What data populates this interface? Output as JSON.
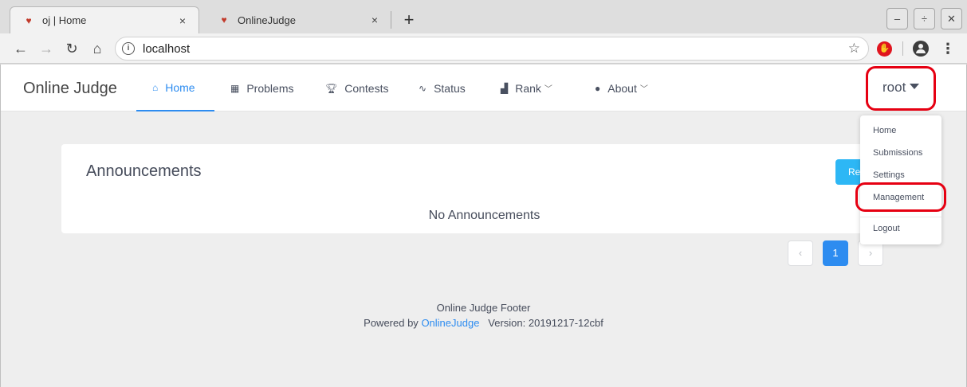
{
  "browser": {
    "tabs": [
      {
        "title": "oj | Home",
        "favicon": "oj-logo-icon"
      },
      {
        "title": "OnlineJudge",
        "favicon": "oj-logo-icon"
      }
    ],
    "new_tab_symbol": "+",
    "tab_close_symbol": "×",
    "window_buttons": [
      "–",
      "÷",
      "✕"
    ],
    "address": "localhost"
  },
  "site": {
    "brand": "Online Judge",
    "nav": [
      {
        "label": "Home",
        "icon": "home-icon",
        "active": true
      },
      {
        "label": "Problems",
        "icon": "grid-icon"
      },
      {
        "label": "Contests",
        "icon": "trophy-icon"
      },
      {
        "label": "Status",
        "icon": "pulse-icon"
      },
      {
        "label": "Rank",
        "icon": "bar-chart-icon",
        "has_dropdown": true
      },
      {
        "label": "About",
        "icon": "info-icon",
        "has_dropdown": true
      }
    ],
    "user": "root",
    "user_menu": [
      "Home",
      "Submissions",
      "Settings",
      "Management",
      "Logout"
    ]
  },
  "announcements": {
    "title": "Announcements",
    "refresh_label": "Refresh",
    "empty_message": "No Announcements"
  },
  "pagination": {
    "prev": "‹",
    "current": "1",
    "next": "›"
  },
  "footer": {
    "line1": "Online Judge Footer",
    "powered_prefix": "Powered by",
    "powered_link": "OnlineJudge",
    "version": "Version: 20191217-12cbf"
  },
  "colors": {
    "accent": "#2d8cf0",
    "refresh_button": "#2db7f5",
    "highlight_ring": "#e60012",
    "page_background": "#eeeeee"
  }
}
